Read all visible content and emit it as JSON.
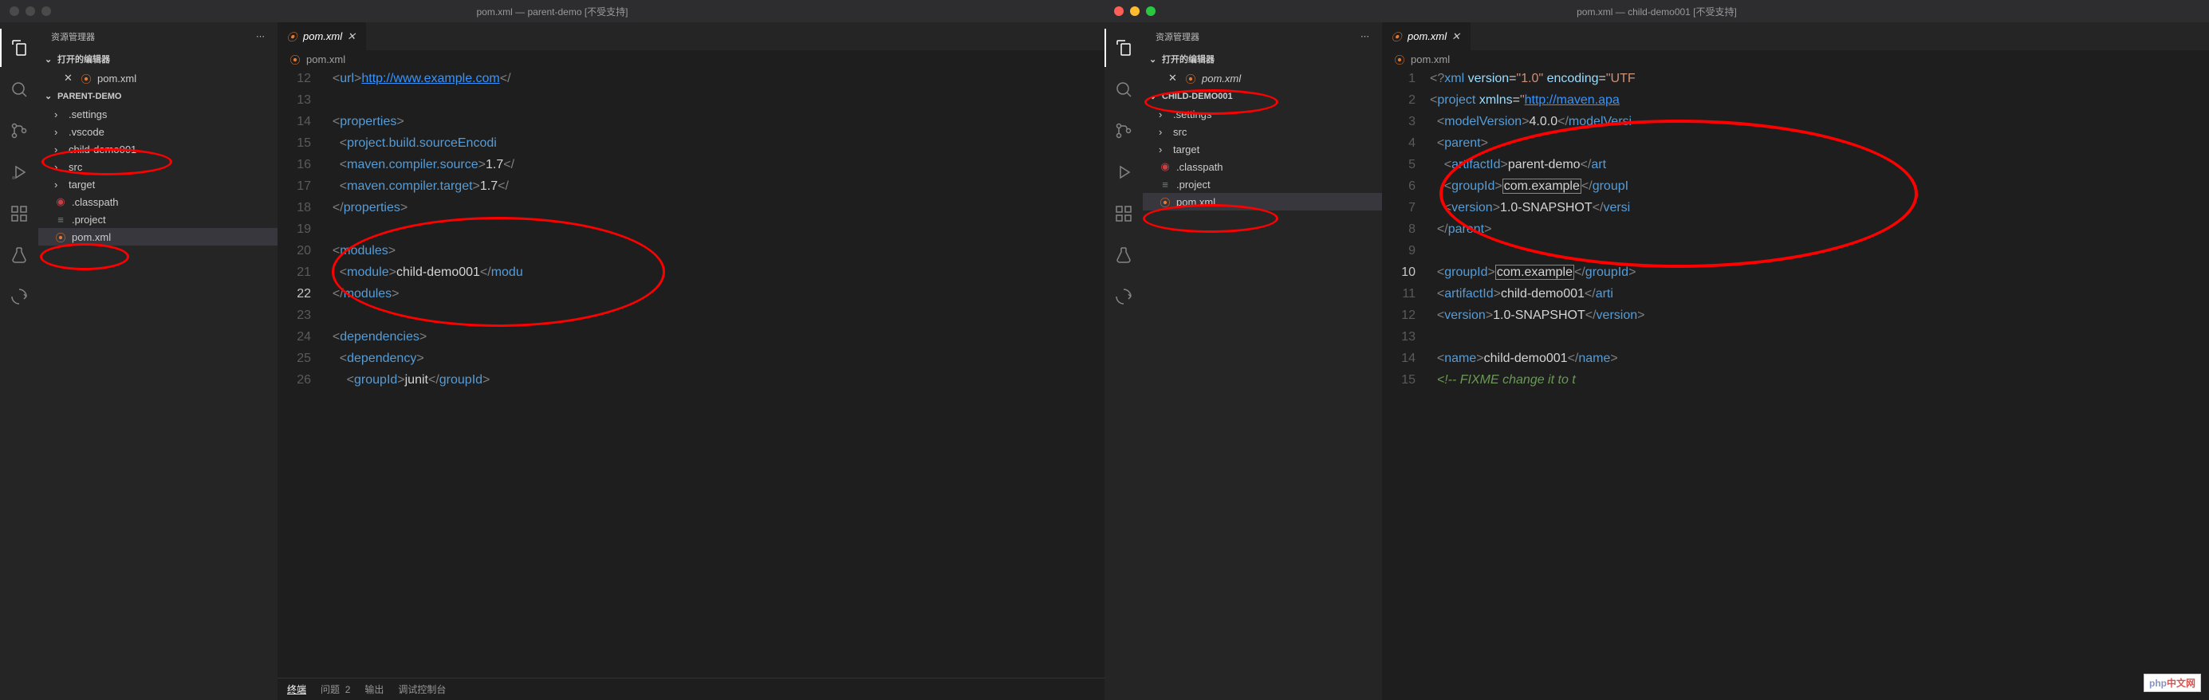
{
  "left": {
    "title": "pom.xml — parent-demo [不受支持]",
    "explorer_label": "资源管理器",
    "open_editors": "打开的编辑器",
    "project_name": "PARENT-DEMO",
    "open_file": "pom.xml",
    "tree": {
      "settings": ".settings",
      "vscode": ".vscode",
      "child": "child-demo001",
      "src": "src",
      "target": "target",
      "classpath": ".classpath",
      "project": ".project",
      "pom": "pom.xml"
    },
    "tab": "pom.xml",
    "breadcrumb": "pom.xml",
    "gutter": [
      "12",
      "13",
      "14",
      "15",
      "16",
      "17",
      "18",
      "19",
      "20",
      "21",
      "22",
      "23",
      "24",
      "25",
      "26"
    ],
    "current_line": "22",
    "panel": {
      "terminal": "终端",
      "problems": "问题",
      "count": "2",
      "output": "输出",
      "debug": "调试控制台"
    }
  },
  "right": {
    "title": "pom.xml — child-demo001 [不受支持]",
    "explorer_label": "资源管理器",
    "open_editors": "打开的编辑器",
    "project_name": "CHILD-DEMO001",
    "open_file": "pom.xml",
    "tree": {
      "settings": ".settings",
      "src": "src",
      "target": "target",
      "classpath": ".classpath",
      "project": ".project",
      "pom": "pom.xml"
    },
    "tab": "pom.xml",
    "breadcrumb": "pom.xml",
    "gutter": [
      "1",
      "2",
      "3",
      "4",
      "5",
      "6",
      "7",
      "8",
      "9",
      "10",
      "11",
      "12",
      "13",
      "14",
      "15"
    ],
    "current_line": "10"
  },
  "code_left": {
    "url": "http://www.example.com",
    "module_name": "child-demo001",
    "src_ver": "1.7",
    "junit": "junit"
  },
  "code_right": {
    "parent_aid": "parent-demo",
    "gid": "com.example",
    "ver": "1.0-SNAPSHOT",
    "child_aid": "child-demo001",
    "child_name": "child-demo001",
    "modelver": "4.0.0",
    "maven_url": "http://maven.apa",
    "comment": "FIXME change it to t"
  },
  "php_badge": "php"
}
